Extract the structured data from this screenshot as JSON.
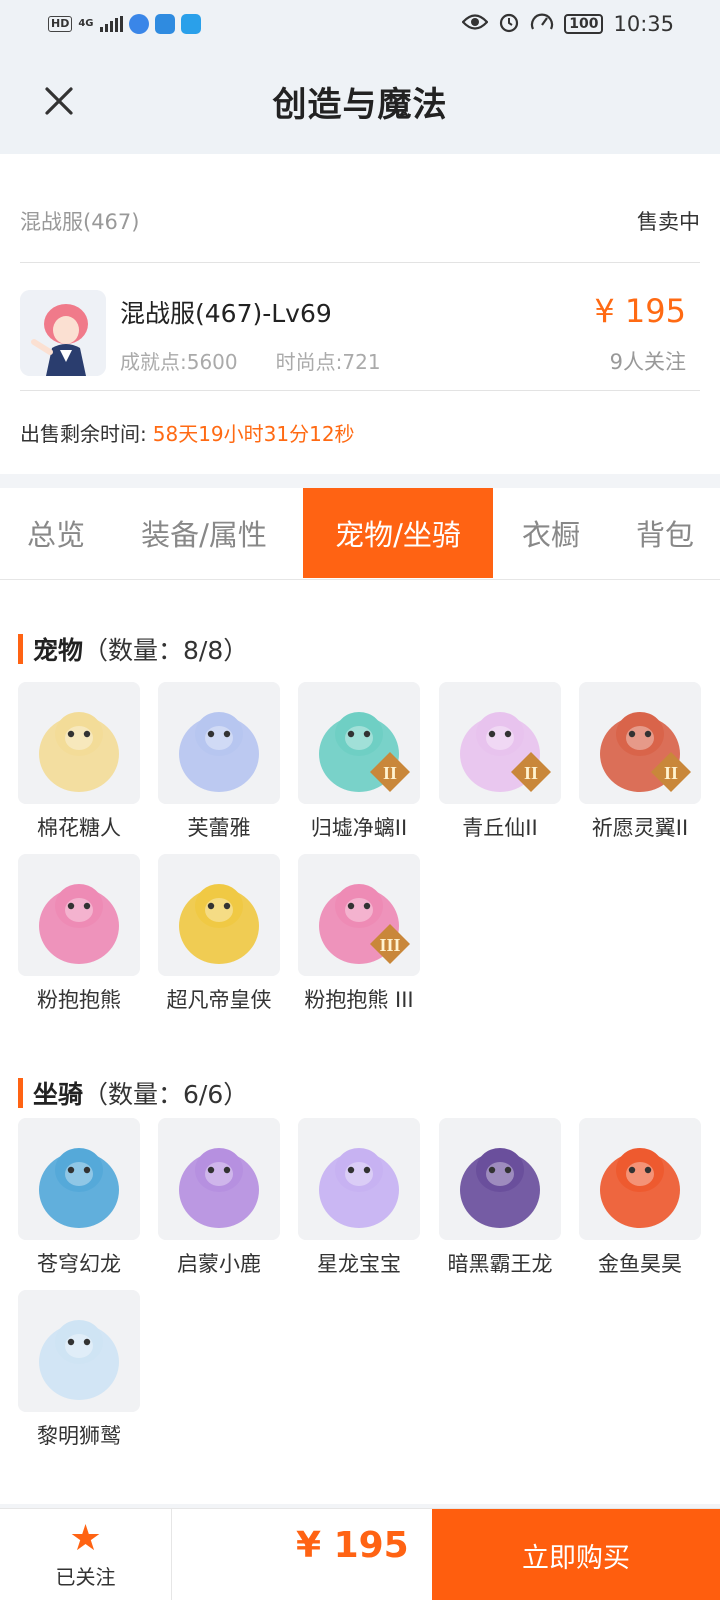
{
  "status_bar": {
    "hd": "HD",
    "network": "4G",
    "battery": "100",
    "time": "10:35"
  },
  "header": {
    "title": "创造与魔法",
    "close_icon": "close-icon"
  },
  "listing": {
    "server": "混战服(467)",
    "sale_status": "售卖中",
    "role_name": "混战服(467)-Lv69",
    "achievement": "成就点:5600",
    "fashion": "时尚点:721",
    "price": "¥ 195",
    "followers": "9人关注",
    "remain_label": "出售剩余时间:",
    "remain_value": "58天19小时31分12秒"
  },
  "tabs": [
    {
      "label": "总览",
      "active": false
    },
    {
      "label": "装备/属性",
      "active": false
    },
    {
      "label": "宠物/坐骑",
      "active": true
    },
    {
      "label": "衣橱",
      "active": false
    },
    {
      "label": "背包",
      "active": false
    }
  ],
  "pets": {
    "title": "宠物",
    "count": "（数量：8/8）",
    "items": [
      {
        "name": "棉花糖人",
        "icon": "cotton-candy-pet-icon",
        "color": "#f3dc98",
        "badge": ""
      },
      {
        "name": "芙蕾雅",
        "icon": "freya-pet-icon",
        "color": "#b7c6f0",
        "badge": ""
      },
      {
        "name": "归墟净螭II",
        "icon": "dragon-pet-icon",
        "color": "#6fcfc4",
        "badge": "II"
      },
      {
        "name": "青丘仙II",
        "icon": "fox-fairy-pet-icon",
        "color": "#e8c3ee",
        "badge": "II"
      },
      {
        "name": "祈愿灵翼II",
        "icon": "eagle-pet-icon",
        "color": "#d9644a",
        "badge": "II"
      },
      {
        "name": "粉抱抱熊",
        "icon": "pink-bear-pet-icon",
        "color": "#ee8bb5",
        "badge": ""
      },
      {
        "name": "超凡帝皇侠",
        "icon": "emperor-knight-pet-icon",
        "color": "#f0c944",
        "badge": ""
      },
      {
        "name": "粉抱抱熊 III",
        "icon": "pink-bear-pet-icon",
        "color": "#ee8bb5",
        "badge": "III"
      }
    ]
  },
  "mounts": {
    "title": "坐骑",
    "count": "（数量：6/6）",
    "items": [
      {
        "name": "苍穹幻龙",
        "icon": "sky-dragon-mount-icon",
        "color": "#55a9d9",
        "badge": ""
      },
      {
        "name": "启蒙小鹿",
        "icon": "fawn-mount-icon",
        "color": "#b690e0",
        "badge": ""
      },
      {
        "name": "星龙宝宝",
        "icon": "star-dragon-mount-icon",
        "color": "#c7b2f2",
        "badge": ""
      },
      {
        "name": "暗黑霸王龙",
        "icon": "dark-trex-mount-icon",
        "color": "#6a4f9c",
        "badge": ""
      },
      {
        "name": "金鱼昊昊",
        "icon": "goldfish-mount-icon",
        "color": "#ee5a2f",
        "badge": ""
      },
      {
        "name": "黎明狮鹫",
        "icon": "griffin-mount-icon",
        "color": "#cfe4f4",
        "badge": ""
      }
    ]
  },
  "bottom": {
    "follow_label": "已关注",
    "price": "¥ 195",
    "buy_label": "立即购买"
  },
  "colors": {
    "accent": "#ff6313",
    "price": "#ff6a13"
  }
}
